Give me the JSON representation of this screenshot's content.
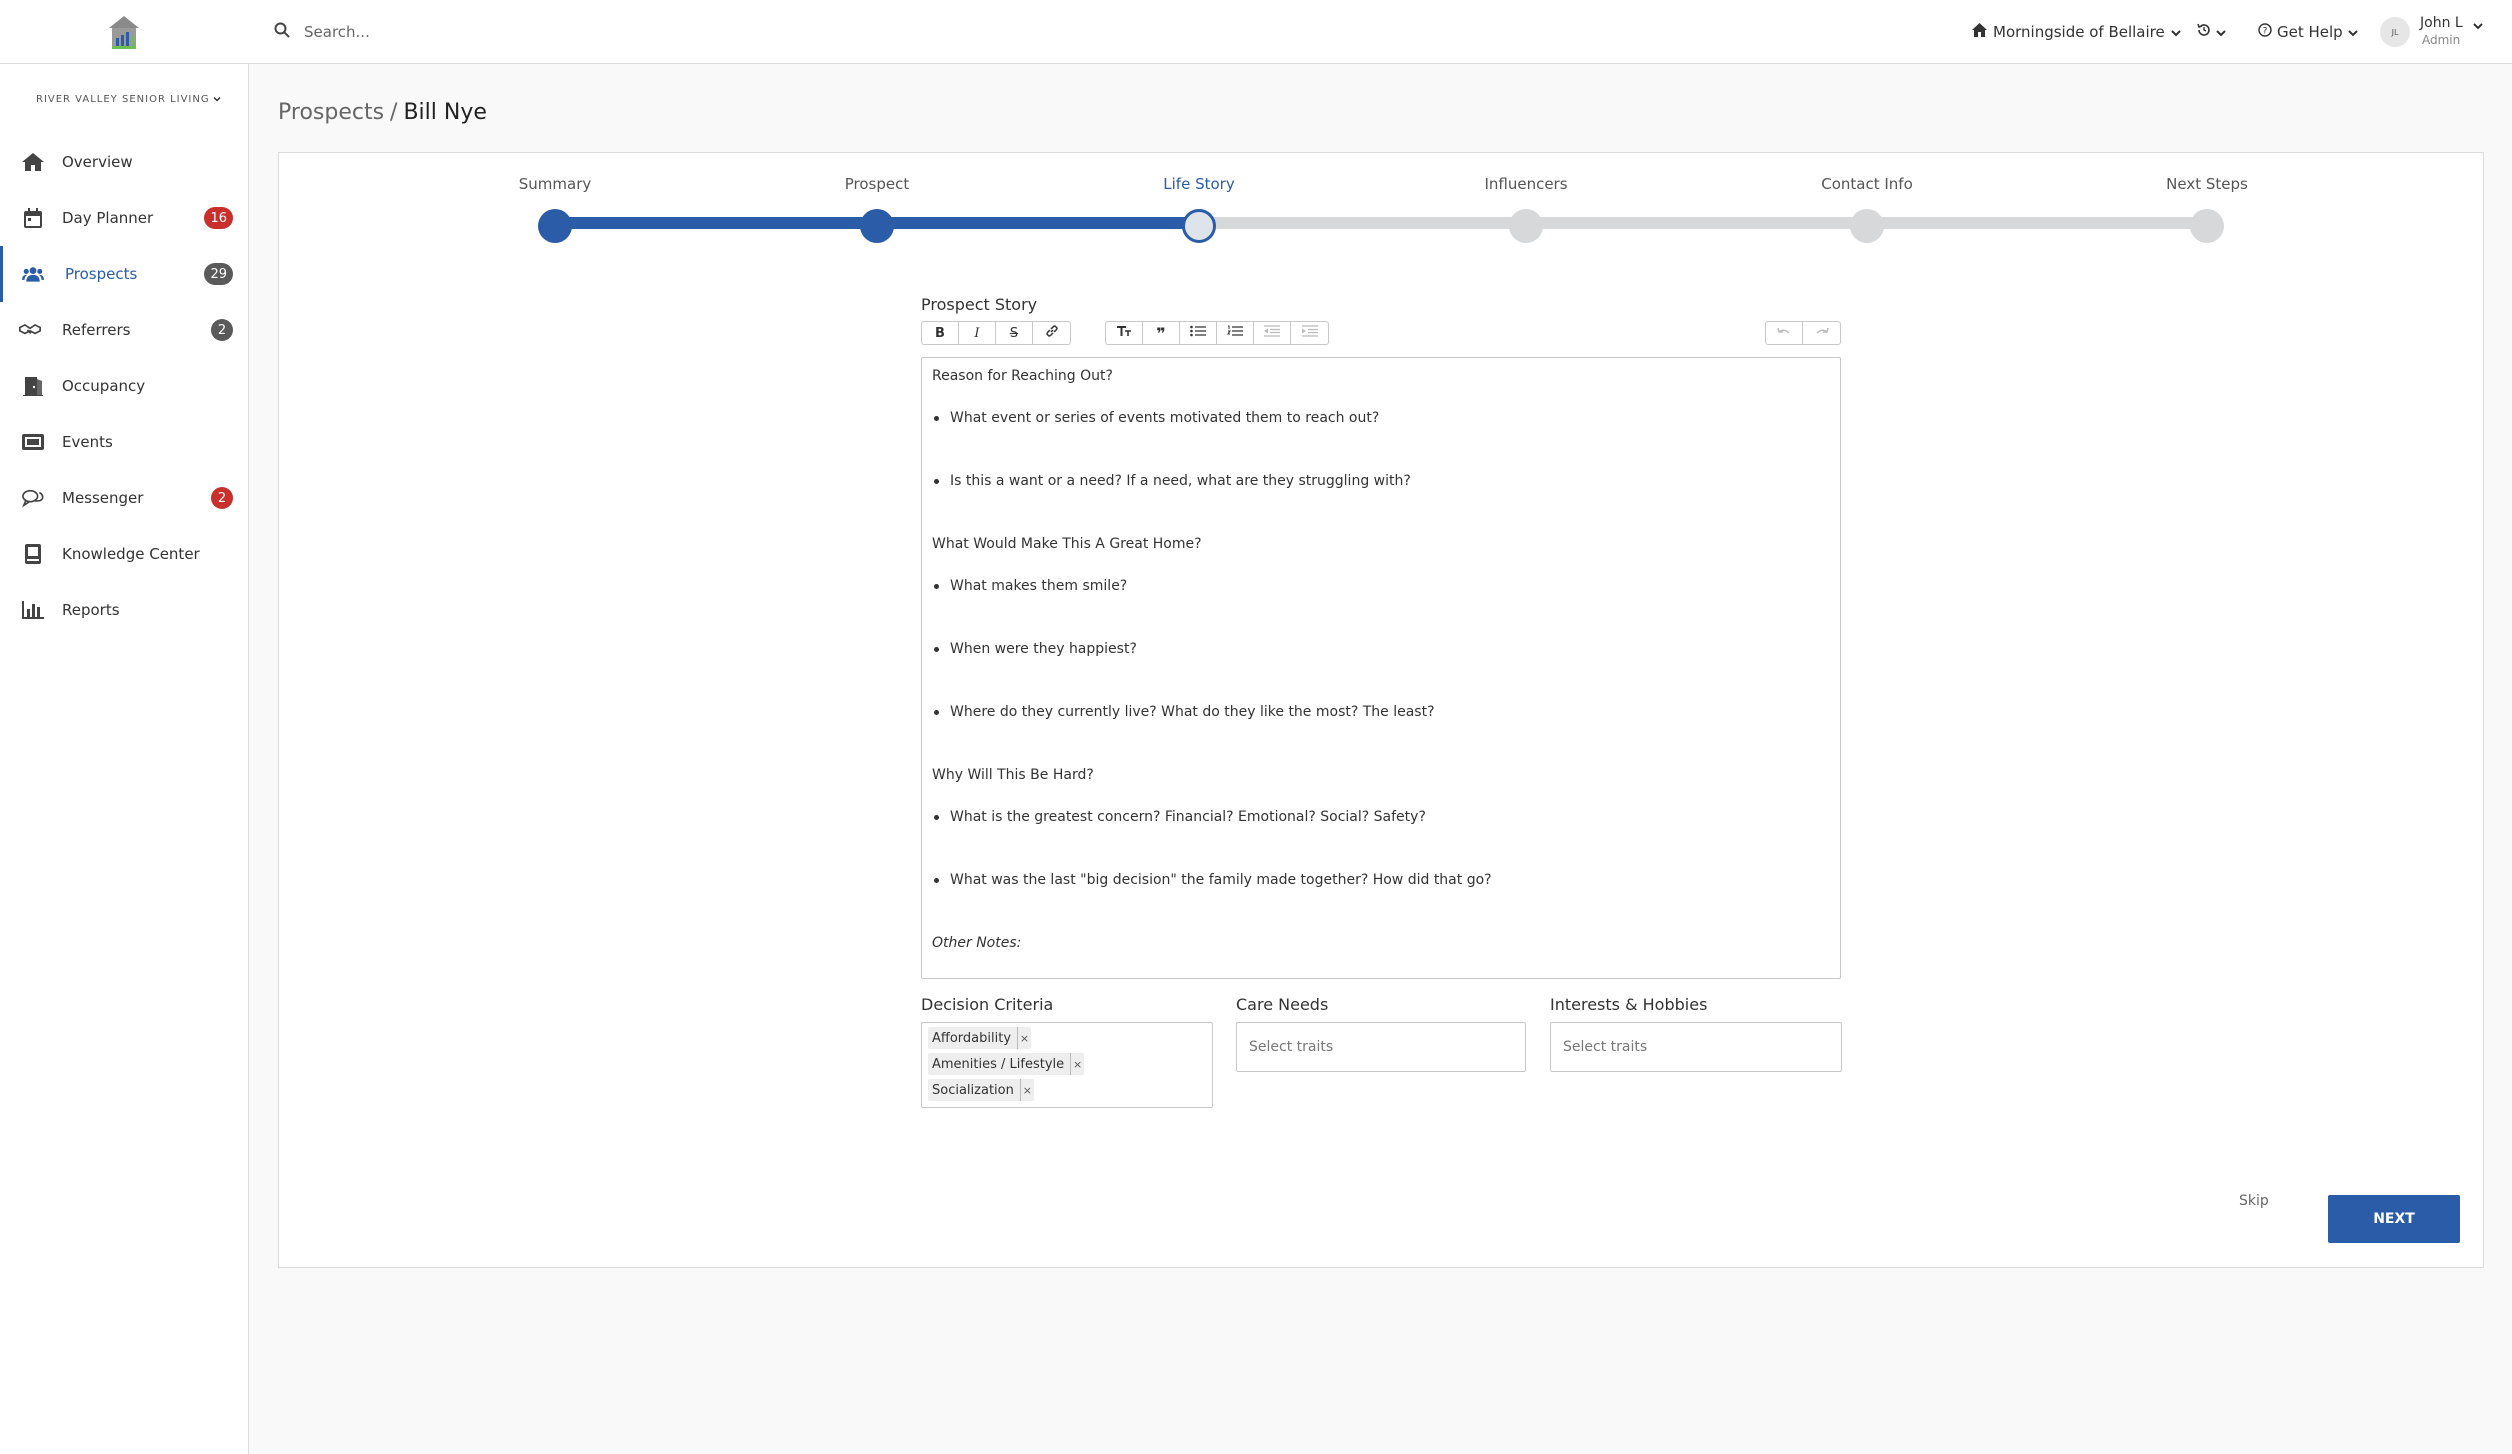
{
  "header": {
    "search_placeholder": "Search...",
    "community": "Morningside of Bellaire",
    "help_label": "Get Help",
    "user": {
      "initials": "JL",
      "name": "John L",
      "role": "Admin"
    }
  },
  "sidebar": {
    "org_name": "RIVER VALLEY SENIOR LIVING",
    "items": [
      {
        "label": "Overview",
        "icon": "home-icon"
      },
      {
        "label": "Day Planner",
        "icon": "calendar-icon",
        "badge": "16",
        "badge_color": "#c9302c"
      },
      {
        "label": "Prospects",
        "icon": "users-icon",
        "badge": "29",
        "badge_color": "#5a5a5a",
        "active": true
      },
      {
        "label": "Referrers",
        "icon": "handshake-icon",
        "badge": "2",
        "badge_color": "#5a5a5a"
      },
      {
        "label": "Occupancy",
        "icon": "door-icon"
      },
      {
        "label": "Events",
        "icon": "ticket-icon"
      },
      {
        "label": "Messenger",
        "icon": "chat-icon",
        "badge": "2",
        "badge_color": "#c9302c"
      },
      {
        "label": "Knowledge Center",
        "icon": "book-icon"
      },
      {
        "label": "Reports",
        "icon": "bar-chart-icon"
      }
    ]
  },
  "breadcrumb": {
    "parent": "Prospects",
    "separator": "/",
    "current": "Bill Nye"
  },
  "stepper": {
    "steps": [
      "Summary",
      "Prospect",
      "Life Story",
      "Influencers",
      "Contact Info",
      "Next Steps"
    ],
    "current_index": 2
  },
  "story": {
    "label": "Prospect Story",
    "content": {
      "h1": "Reason for Reaching Out?",
      "b1": "What event or series of events motivated them to reach out?",
      "b2": "Is this a want or a need?  If a need, what are they struggling with?",
      "h2": "What Would Make This A Great Home?",
      "b3": "What makes them smile?",
      "b4": "When were they happiest?",
      "b5": "Where do they currently live?  What do they like the most?  The least?",
      "h3": "Why Will This Be Hard?",
      "b6": "What is the greatest concern?  Financial?  Emotional?  Social?  Safety?",
      "b7": "What was the last \"big decision\" the family made together?  How did that go?",
      "notes": "Other Notes:"
    }
  },
  "traits": {
    "decision_label": "Decision Criteria",
    "decision_tags": [
      "Affordability",
      "Amenities / Lifestyle",
      "Socialization"
    ],
    "tag_remove": "×",
    "care_label": "Care Needs",
    "care_placeholder": "Select traits",
    "interests_label": "Interests & Hobbies",
    "interests_placeholder": "Select traits"
  },
  "actions": {
    "skip": "Skip",
    "next": "NEXT"
  },
  "colors": {
    "primary": "#2a5ca8",
    "badge_red": "#c9302c",
    "badge_gray": "#5a5a5a",
    "track": "#d6d8da"
  }
}
